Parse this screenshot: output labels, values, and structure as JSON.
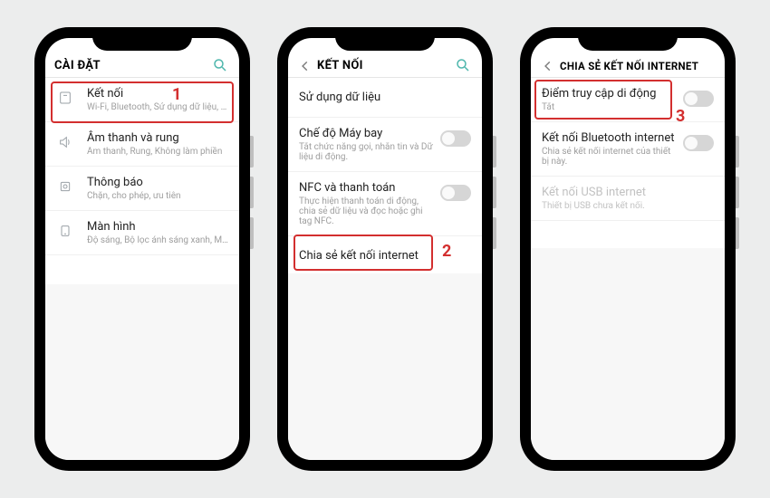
{
  "highlight_color": "#d32f2f",
  "phone1": {
    "header_title": "CÀI ĐẶT",
    "step_number": "1",
    "items": [
      {
        "label": "Kết nối",
        "desc": "Wi-Fi, Bluetooth, Sử dụng dữ liệu, Chế đ..."
      },
      {
        "label": "Âm thanh và rung",
        "desc": "Âm thanh, Rung, Không làm phiền"
      },
      {
        "label": "Thông báo",
        "desc": "Chặn, cho phép, ưu tiên"
      },
      {
        "label": "Màn hình",
        "desc": "Độ sáng, Bộ lọc ánh sáng xanh, Màn hì..."
      }
    ]
  },
  "phone2": {
    "header_title": "KẾT NỐI",
    "step_number": "2",
    "items": [
      {
        "label": "Sử dụng dữ liệu"
      },
      {
        "label": "Chế độ Máy bay",
        "desc": "Tắt chức năng gọi, nhắn tin và Dữ liệu di động.",
        "toggle": true
      },
      {
        "label": "NFC và thanh toán",
        "desc": "Thực hiện thanh toán di động, chia sẻ dữ liệu và đọc hoặc ghi tag NFC.",
        "toggle": true
      },
      {
        "label": "Chia sẻ kết nối internet"
      }
    ]
  },
  "phone3": {
    "header_title": "CHIA SẺ KẾT NỐI INTERNET",
    "step_number": "3",
    "items": [
      {
        "label": "Điểm truy cập di động",
        "desc": "Tắt",
        "toggle": true
      },
      {
        "label": "Kết nối Bluetooth internet",
        "desc": "Chia sẻ kết nối internet của thiết bị này.",
        "toggle": true
      },
      {
        "label": "Kết nối USB internet",
        "desc": "Thiết bị USB chưa kết nối.",
        "disabled": true
      }
    ]
  }
}
